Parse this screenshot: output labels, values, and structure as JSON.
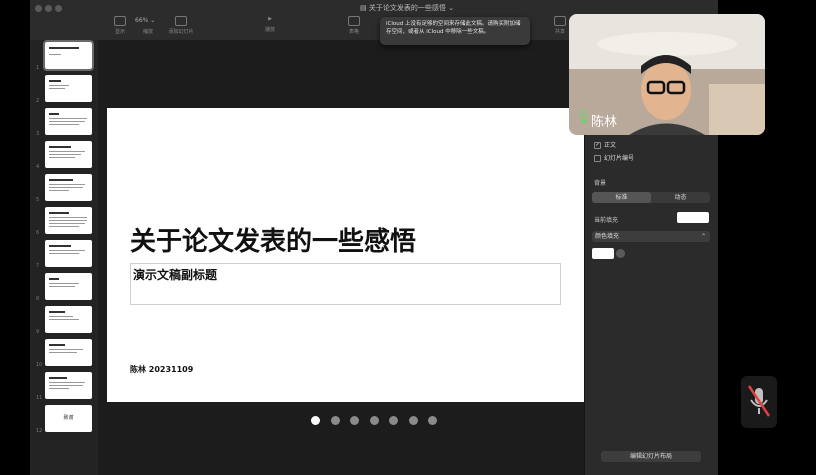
{
  "window": {
    "doc_title": "关于论文发表的一些感悟",
    "zoom": "66%",
    "toolbar": [
      {
        "label": "显示"
      },
      {
        "label": "缩放"
      },
      {
        "label": "添加幻灯片"
      },
      {
        "label": "播放"
      },
      {
        "label": "表格"
      },
      {
        "label": "共享"
      }
    ]
  },
  "toast": {
    "text": "iCloud 上没有足够的空间来存储此文稿。请购买附加储存空间，或者从 iCloud 中移除一些文稿。"
  },
  "navigator": {
    "slide_numbers": [
      "1",
      "2",
      "3",
      "4",
      "5",
      "6",
      "7",
      "8",
      "9",
      "10",
      "11",
      "12"
    ],
    "last_thumb_text": "致谢"
  },
  "slide": {
    "title": "关于论文发表的一些感悟",
    "subtitle": "演示文稿副标题",
    "author": "陈林 20231109"
  },
  "inspector": {
    "show_body": "正文",
    "slide_number": "幻灯片编号",
    "background_label": "背景",
    "seg_standard": "标准",
    "seg_dynamic": "动态",
    "current_fill": "当前填充",
    "fill_type": "颜色填充",
    "edit_layout": "编辑幻灯片布局"
  },
  "video": {
    "participant": "陈林"
  },
  "pager": {
    "count": 7,
    "active": 0
  }
}
